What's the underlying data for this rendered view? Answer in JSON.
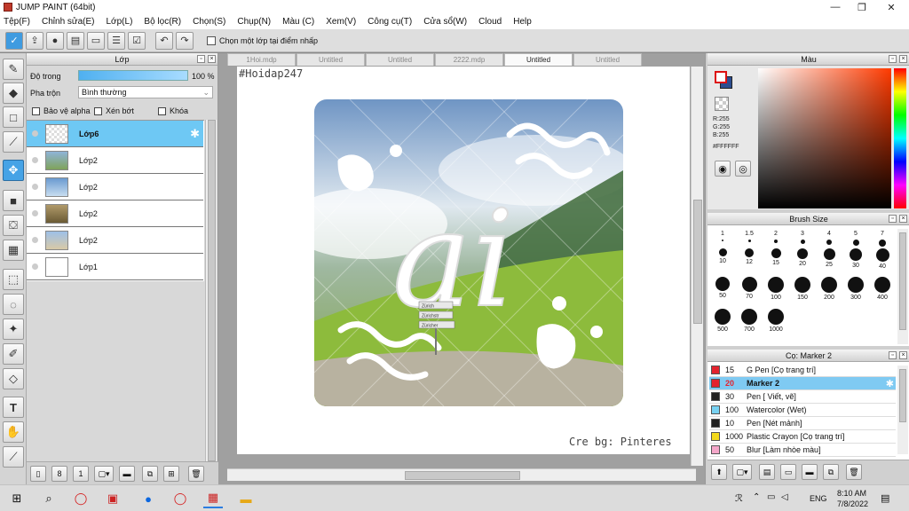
{
  "window": {
    "title": "JUMP PAINT (64bit)",
    "minimize": "—",
    "maximize": "❐",
    "close": "✕"
  },
  "menu": [
    "Tệp(F)",
    "Chỉnh sửa(E)",
    "Lớp(L)",
    "Bộ lọc(R)",
    "Chọn(S)",
    "Chụp(N)",
    "Màu (C)",
    "Xem(V)",
    "Công cụ(T)",
    "Cửa sổ(W)",
    "Cloud",
    "Help"
  ],
  "toolbar": {
    "select_layer_checkbox": "Chọn một lớp tại điểm nhấp"
  },
  "layer_panel": {
    "title": "Lớp",
    "opacity_label": "Độ trong",
    "opacity_value": "100 %",
    "blend_label": "Pha trộn",
    "blend_value": "Bình thường",
    "protect_alpha": "Bảo vệ alpha",
    "clip": "Xén bớt",
    "lock": "Khóa",
    "layers": [
      {
        "name": "Lớp6",
        "selected": true
      },
      {
        "name": "Lớp2"
      },
      {
        "name": "Lớp2"
      },
      {
        "name": "Lớp2"
      },
      {
        "name": "Lớp2"
      },
      {
        "name": "Lớp1"
      }
    ]
  },
  "canvas": {
    "tabs": [
      "1Hoi.mdp",
      "Untitled",
      "Untitled",
      "2222.mdp",
      "Untitled",
      "Untitled"
    ],
    "active_tab": 4,
    "hashtag_text": "#Hoidap247",
    "credit_text": "Cre bg: Pinteres",
    "artwork_letters": "ai",
    "sign_text": [
      "Zürich",
      "Zürichstr",
      "Züricher"
    ]
  },
  "color_panel": {
    "title": "Màu",
    "r": "R:255",
    "g": "G:255",
    "b": "B:255",
    "hex": "#FFFFFF",
    "foreground": "#ffffff",
    "background": "#2c4d8f"
  },
  "brush_panel": {
    "title": "Brush Size",
    "sizes": [
      "1",
      "1.5",
      "2",
      "3",
      "4",
      "5",
      "7",
      "10",
      "12",
      "15",
      "20",
      "25",
      "30",
      "40",
      "50",
      "70",
      "100",
      "150",
      "200",
      "300",
      "400",
      "500",
      "700",
      "1000"
    ]
  },
  "marker_panel": {
    "title": "Cọ: Marker 2",
    "items": [
      {
        "size": "15",
        "name": "G Pen [Cọ trang trí]",
        "color": "#e3232e"
      },
      {
        "size": "20",
        "name": "Marker 2",
        "color": "#e3232e",
        "selected": true
      },
      {
        "size": "30",
        "name": "Pen [ Viết, vẽ]",
        "color": "#222222"
      },
      {
        "size": "100",
        "name": "Watercolor (Wet)",
        "color": "#78d2f2"
      },
      {
        "size": "10",
        "name": "Pen [Nét mảnh]",
        "color": "#222222"
      },
      {
        "size": "1000",
        "name": "Plastic Crayon [Cọ trang trí]",
        "color": "#f2d91c"
      },
      {
        "size": "50",
        "name": "Blur [Làm nhòe màu]",
        "color": "#f4a6c9"
      }
    ]
  },
  "taskbar": {
    "lang": "ENG",
    "time": "8:10 AM",
    "date": "7/8/2022"
  }
}
